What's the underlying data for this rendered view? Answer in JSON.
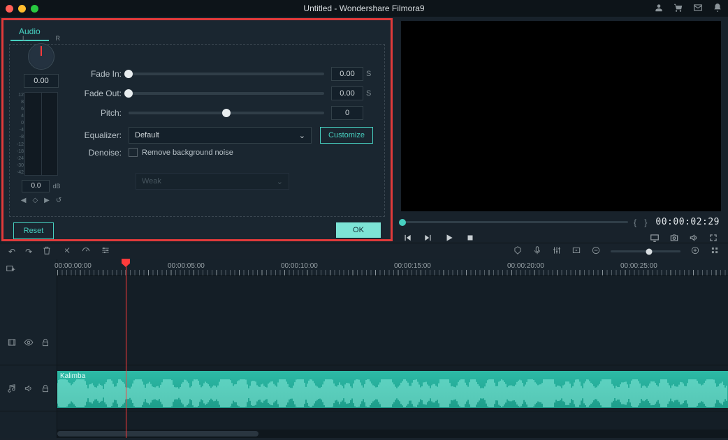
{
  "title": "Untitled - Wondershare Filmora9",
  "audio_panel": {
    "tab": "Audio",
    "balance": {
      "L": "L",
      "R": "R",
      "value": "0.00"
    },
    "meter_scale": [
      "12",
      "8",
      "6",
      "4",
      "0",
      "-4",
      "-8",
      "-12",
      "-18",
      "-24",
      "-30",
      "-42"
    ],
    "volume": {
      "value": "0.0",
      "unit": "dB"
    },
    "fade_in": {
      "label": "Fade In:",
      "value": "0.00",
      "unit": "S"
    },
    "fade_out": {
      "label": "Fade Out:",
      "value": "0.00",
      "unit": "S"
    },
    "pitch": {
      "label": "Pitch:",
      "value": "0"
    },
    "equalizer": {
      "label": "Equalizer:",
      "value": "Default",
      "customize": "Customize"
    },
    "denoise": {
      "label": "Denoise:",
      "checkbox": "Remove background noise",
      "strength": "Weak"
    },
    "reset": "Reset",
    "ok": "OK"
  },
  "preview": {
    "timecode": "00:00:02:29"
  },
  "ruler": [
    "00:00:00:00",
    "00:00:05:00",
    "00:00:10:00",
    "00:00:15:00",
    "00:00:20:00",
    "00:00:25:00"
  ],
  "clip": {
    "name": "Kalimba"
  }
}
